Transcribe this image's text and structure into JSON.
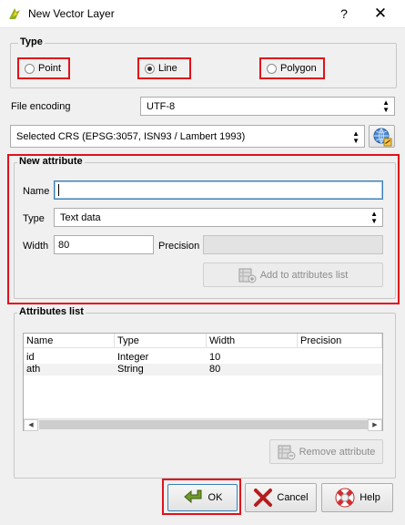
{
  "window": {
    "title": "New Vector Layer",
    "help_glyph": "?",
    "close_glyph": "✕"
  },
  "type_group": {
    "title": "Type",
    "options": [
      {
        "label": "Point",
        "checked": false
      },
      {
        "label": "Line",
        "checked": true
      },
      {
        "label": "Polygon",
        "checked": false
      }
    ]
  },
  "file_encoding": {
    "label": "File encoding",
    "value": "UTF-8"
  },
  "crs": {
    "value": "Selected CRS (EPSG:3057, ISN93 / Lambert 1993)",
    "icon": "globe-icon"
  },
  "new_attribute": {
    "title": "New attribute",
    "name_label": "Name",
    "name_value": "",
    "type_label": "Type",
    "type_value": "Text data",
    "width_label": "Width",
    "width_value": "80",
    "precision_label": "Precision",
    "precision_value": "",
    "add_button": "Add to attributes list"
  },
  "attributes_list": {
    "title": "Attributes list",
    "columns": [
      "Name",
      "Type",
      "Width",
      "Precision"
    ],
    "rows": [
      [
        "id",
        "Integer",
        "10",
        ""
      ],
      [
        "ath",
        "String",
        "80",
        ""
      ]
    ],
    "remove_button": "Remove attribute"
  },
  "buttons": {
    "ok": "OK",
    "cancel": "Cancel",
    "help": "Help"
  },
  "colors": {
    "highlight": "#e0111b",
    "focus": "#3c7fb1"
  }
}
